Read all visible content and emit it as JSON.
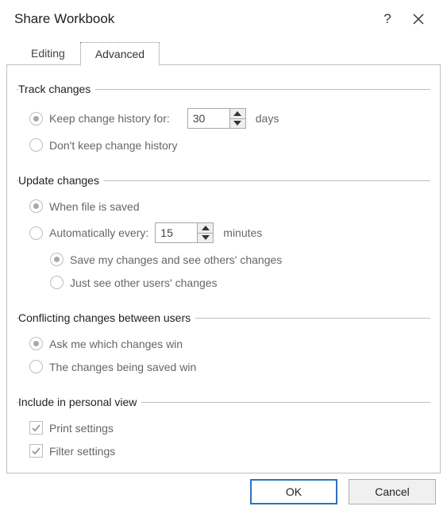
{
  "window": {
    "title": "Share Workbook"
  },
  "tabs": {
    "editing": "Editing",
    "advanced": "Advanced",
    "active": "advanced"
  },
  "groups": {
    "track": {
      "legend": "Track changes",
      "keep_label": "Keep change history for:",
      "keep_days": "30",
      "keep_unit": "days",
      "dont_keep_label": "Don't keep change history",
      "selected": "keep"
    },
    "update": {
      "legend": "Update changes",
      "when_saved_label": "When file is saved",
      "auto_label": "Automatically every:",
      "auto_minutes": "15",
      "auto_unit": "minutes",
      "selected": "when_saved",
      "sub_selected": "save_mine",
      "save_mine_label": "Save my changes and see others' changes",
      "just_see_label": "Just see other users' changes"
    },
    "conflict": {
      "legend": "Conflicting changes between users",
      "ask_label": "Ask me which changes win",
      "saved_win_label": "The changes being saved win",
      "selected": "ask"
    },
    "personal": {
      "legend": "Include in personal view",
      "print_label": "Print settings",
      "print_checked": true,
      "filter_label": "Filter settings",
      "filter_checked": true
    }
  },
  "buttons": {
    "ok": "OK",
    "cancel": "Cancel"
  }
}
